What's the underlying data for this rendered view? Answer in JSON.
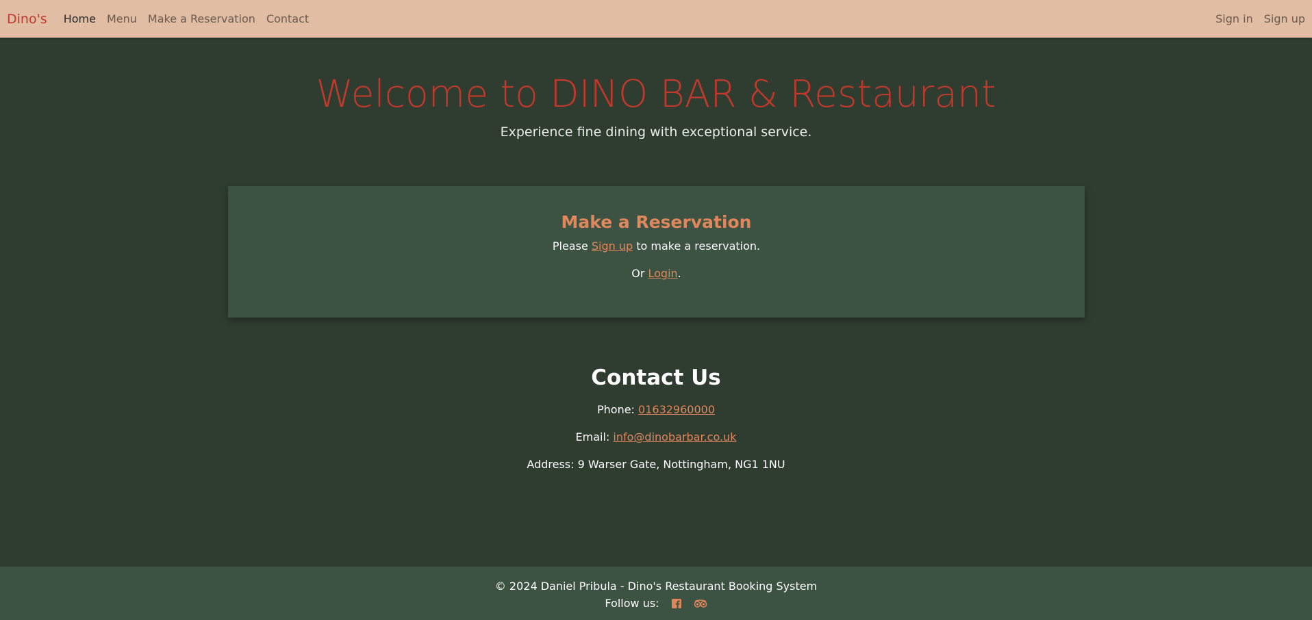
{
  "navbar": {
    "brand": "Dino's",
    "links": [
      "Home",
      "Menu",
      "Make a Reservation",
      "Contact"
    ],
    "right_links": [
      "Sign in",
      "Sign up"
    ],
    "active": "Home"
  },
  "hero": {
    "title": "Welcome to DINO BAR & Restaurant",
    "subtitle": "Experience fine dining with exceptional service."
  },
  "reservation": {
    "title": "Make a Reservation",
    "line1_prefix": "Please ",
    "signup_link": "Sign up",
    "line1_suffix": " to make a reservation.",
    "line2_prefix": "Or ",
    "login_link": "Login",
    "line2_suffix": "."
  },
  "contact": {
    "title": "Contact Us",
    "phone_label": "Phone: ",
    "phone": "01632960000",
    "email_label": "Email: ",
    "email": "info@dinobarbar.co.uk",
    "address": "Address: 9 Warser Gate, Nottingham, NG1 1NU"
  },
  "footer": {
    "copyright": "© 2024 Daniel Pribula - Dino's Restaurant Booking System",
    "follow": "Follow us:",
    "social_icons": [
      "facebook-icon",
      "tripadvisor-icon"
    ]
  },
  "colors": {
    "navbar_bg": "#e0bda3",
    "page_bg": "#2f3d31",
    "card_bg": "#3c5242",
    "brand_red": "#c0392b",
    "accent_orange": "#e0875b"
  }
}
